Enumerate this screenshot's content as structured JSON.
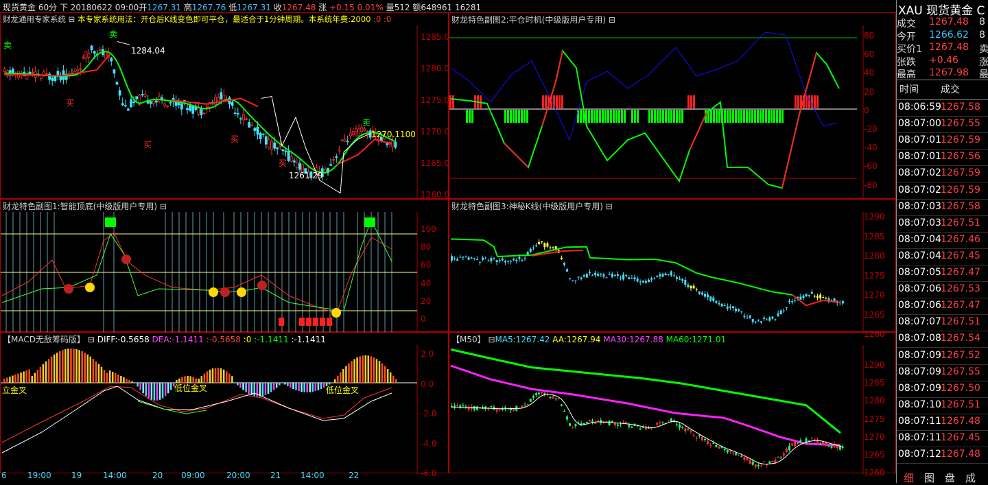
{
  "header": {
    "symbol": "现货黄金",
    "period": "60分",
    "direction": "下",
    "date_time": "20180622 09:00",
    "open_label": "开",
    "open": "1267.31",
    "high_label": "高",
    "high": "1267.76",
    "low_label": "低",
    "low": "1267.31",
    "close_label": "收",
    "close": "1267.48",
    "change_label": "涨",
    "change": "+0.15",
    "change_pct": "0.01%",
    "volume_label": "量",
    "volume": "512",
    "amount_label": "额",
    "amount": "648961",
    "extra": "16281"
  },
  "panels": {
    "main": {
      "title": "财龙通用专家系统",
      "desc": "本专家系统用法：开仓后K线变色即可平仓，最适合于1分钟周期。本系统年费:2000",
      "tail": ":0 :0",
      "y_ticks": [
        "1285.0",
        "1280.0",
        "1275.0",
        "1270.0",
        "1265.0",
        "1260.0"
      ],
      "annotations": {
        "hi": "1284.04",
        "lo": "1261.29",
        "cur": "1270.1100"
      },
      "signals": {
        "sell1": "卖",
        "buy1": "买",
        "buy2": "买",
        "buy3": "买",
        "buy4": "买",
        "sell2": "卖",
        "sell3": "卖"
      }
    },
    "sub1": {
      "title": "财龙特色副图1:智能顶底(中级版用户专用)",
      "y_ticks": [
        "100",
        "80",
        "60",
        "40",
        "20",
        "0"
      ]
    },
    "sub2": {
      "title": "财龙特色副图2:平仓时机(中级版用户专用)",
      "y_ticks": [
        "80",
        "60",
        "40",
        "20",
        "0",
        "-20",
        "-40",
        "-60",
        "-80"
      ]
    },
    "sub3": {
      "title": "财龙特色副图3:神秘K线(中级版用户专用)",
      "y_ticks": [
        "1290",
        "1285",
        "1280",
        "1275",
        "1270",
        "1265",
        "1260"
      ]
    },
    "macd": {
      "title": "【MACD无敌筹码版】",
      "diff": "DIFF:-0.5658",
      "dea": "DEA:-1.1411",
      "v3": ":-0.5658",
      "v4": ":0",
      "v5": ":-1.1411",
      "v6": ":-1.1411",
      "y_ticks": [
        "2.0",
        "0.0",
        "-2.0",
        "-4.0",
        "-6.0"
      ],
      "labels": {
        "a": "立金叉",
        "b": "低位金叉",
        "c": "低位金叉"
      }
    },
    "ma": {
      "title": "【M50】",
      "ma5": "MA5:1267.42",
      "aa": "AA:1267.94",
      "ma30": "MA30:1267.88",
      "ma60": "MA60:1271.01",
      "y_ticks": [
        "1290",
        "1285",
        "1280",
        "1275",
        "1270",
        "1265",
        "1260"
      ]
    }
  },
  "x_axis": [
    "6",
    "19:00",
    "19",
    "14:00",
    "20",
    "09:00",
    "20:00",
    "21",
    "14:00",
    "22"
  ],
  "quote": {
    "title_code": "XAU",
    "title_name": "现货黄金",
    "title_tail": "C",
    "rows": [
      {
        "label": "成交",
        "value": "1267.48",
        "color": "#ff4040",
        "side": "8"
      },
      {
        "label": "今开",
        "value": "1266.62",
        "color": "#40c0ff",
        "side": "8"
      },
      {
        "label": "买价1",
        "value": "1267.48",
        "color": "#ff4040",
        "side": "卖"
      },
      {
        "label": "张跌",
        "value": "+0.46",
        "color": "#ff4040",
        "side": "涨"
      },
      {
        "label": "最高",
        "value": "1267.98",
        "color": "#ff4040",
        "side": "最"
      }
    ],
    "ticks_header": {
      "time": "时间",
      "price": "成交"
    },
    "ticks": [
      {
        "time": "08:06:59",
        "price": "1267.58"
      },
      {
        "time": "08:07:00",
        "price": "1267.55"
      },
      {
        "time": "08:07:01",
        "price": "1267.59"
      },
      {
        "time": "08:07:01",
        "price": "1267.56"
      },
      {
        "time": "08:07:02",
        "price": "1267.59"
      },
      {
        "time": "08:07:02",
        "price": "1267.59"
      },
      {
        "time": "08:07:03",
        "price": "1267.58"
      },
      {
        "time": "08:07:03",
        "price": "1267.51"
      },
      {
        "time": "08:07:04",
        "price": "1267.46"
      },
      {
        "time": "08:07:04",
        "price": "1267.45"
      },
      {
        "time": "08:07:05",
        "price": "1267.47"
      },
      {
        "time": "08:07:06",
        "price": "1267.53"
      },
      {
        "time": "08:07:06",
        "price": "1267.47"
      },
      {
        "time": "08:07:07",
        "price": "1267.51"
      },
      {
        "time": "08:07:08",
        "price": "1267.54"
      },
      {
        "time": "08:07:09",
        "price": "1267.52"
      },
      {
        "time": "08:07:09",
        "price": "1267.55"
      },
      {
        "time": "08:07:09",
        "price": "1267.50"
      },
      {
        "time": "08:07:10",
        "price": "1267.51"
      },
      {
        "time": "08:07:11",
        "price": "1267.48"
      },
      {
        "time": "08:07:11",
        "price": "1267.45"
      },
      {
        "time": "08:07:12",
        "price": "1267.48"
      }
    ],
    "bottom_tabs": [
      "细",
      "图",
      "盘",
      "成"
    ]
  },
  "colors": {
    "up": "#ff3030",
    "down": "#40e0ff",
    "grid": "#b00000",
    "green": "#00ff00",
    "yellow": "#ffff00"
  }
}
